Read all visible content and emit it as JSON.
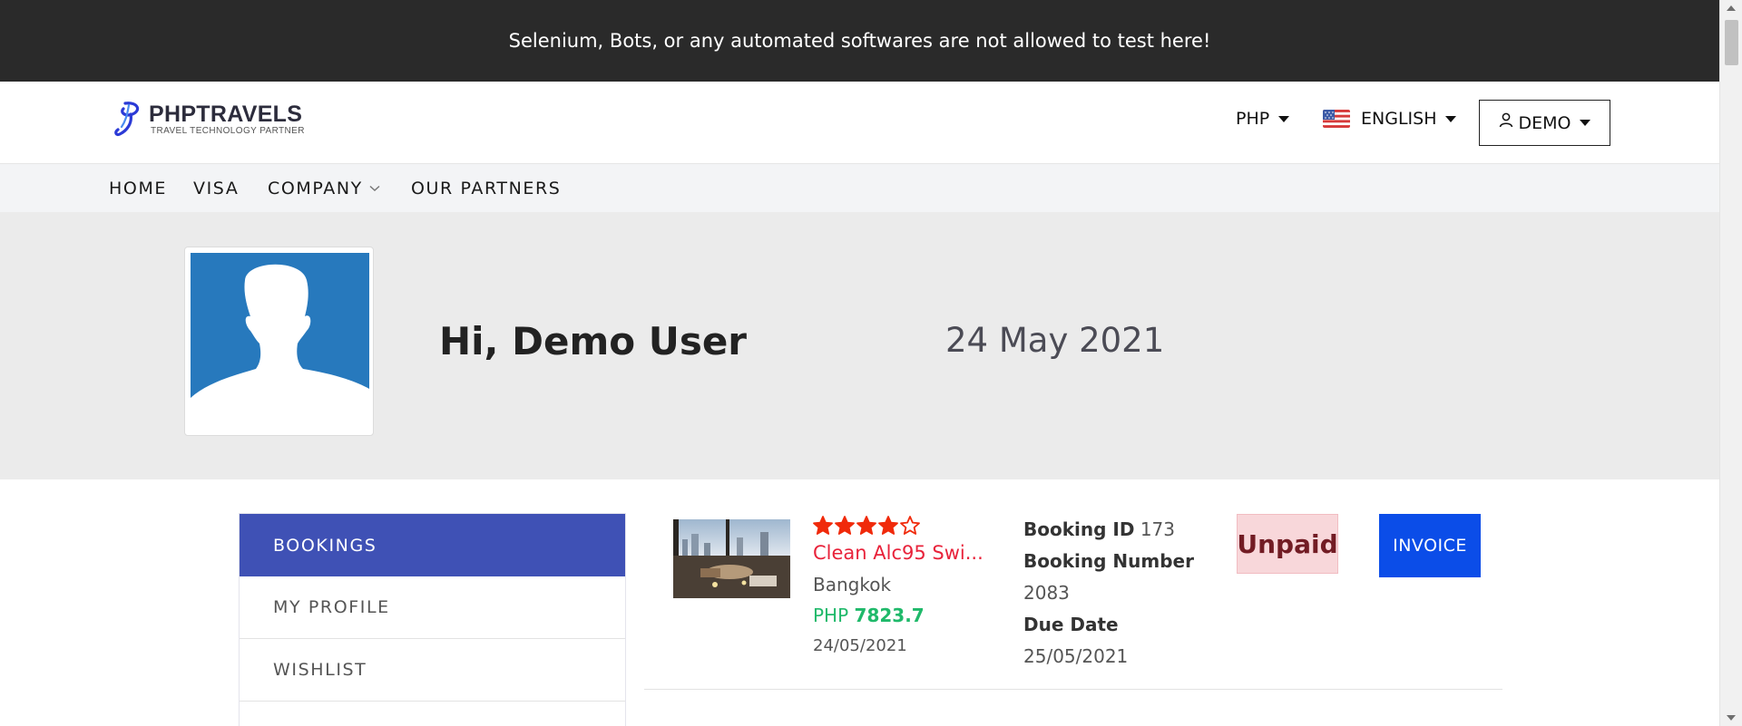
{
  "notice": {
    "text": "Selenium, Bots, or any automated softwares are not allowed to test here!"
  },
  "header": {
    "logo": {
      "title": "PHPTRAVELS",
      "subtitle": "TRAVEL TECHNOLOGY PARTNER"
    },
    "currency": {
      "label": "PHP"
    },
    "language": {
      "label": "ENGLISH",
      "flag_icon": "us-flag-icon"
    },
    "account": {
      "label": "DEMO",
      "icon": "user-icon"
    }
  },
  "nav": {
    "items": [
      {
        "label": "HOME"
      },
      {
        "label": "VISA"
      },
      {
        "label": "COMPANY"
      },
      {
        "label": "OUR PARTNERS"
      }
    ]
  },
  "hero": {
    "greeting": "Hi, Demo User",
    "date": "24 May 2021",
    "avatar_color": "#2779bd"
  },
  "sidebar": {
    "items": [
      {
        "label": "BOOKINGS",
        "active": true
      },
      {
        "label": "MY PROFILE"
      },
      {
        "label": "WISHLIST"
      }
    ]
  },
  "booking": {
    "rating": 4,
    "rating_max": 5,
    "hotel_name": "Clean Alc95 Swi...",
    "city": "Bangkok",
    "currency": "PHP",
    "price": "7823.7",
    "date": "24/05/2021",
    "booking_id_label": "Booking ID",
    "booking_id": "173",
    "booking_number_label": "Booking Number",
    "booking_number": "2083",
    "due_date_label": "Due Date",
    "due_date": "25/05/2021",
    "status": "Unpaid",
    "invoice_label": "INVOICE"
  },
  "colors": {
    "notice_bg": "#2a2a2a",
    "accent_sidebar": "#3f51b5",
    "invoice_button": "#0b4de8",
    "hotel_name": "#e8223a",
    "price": "#1fb96a",
    "star": "#f02a0b",
    "unpaid_bg": "#f8d7da"
  }
}
